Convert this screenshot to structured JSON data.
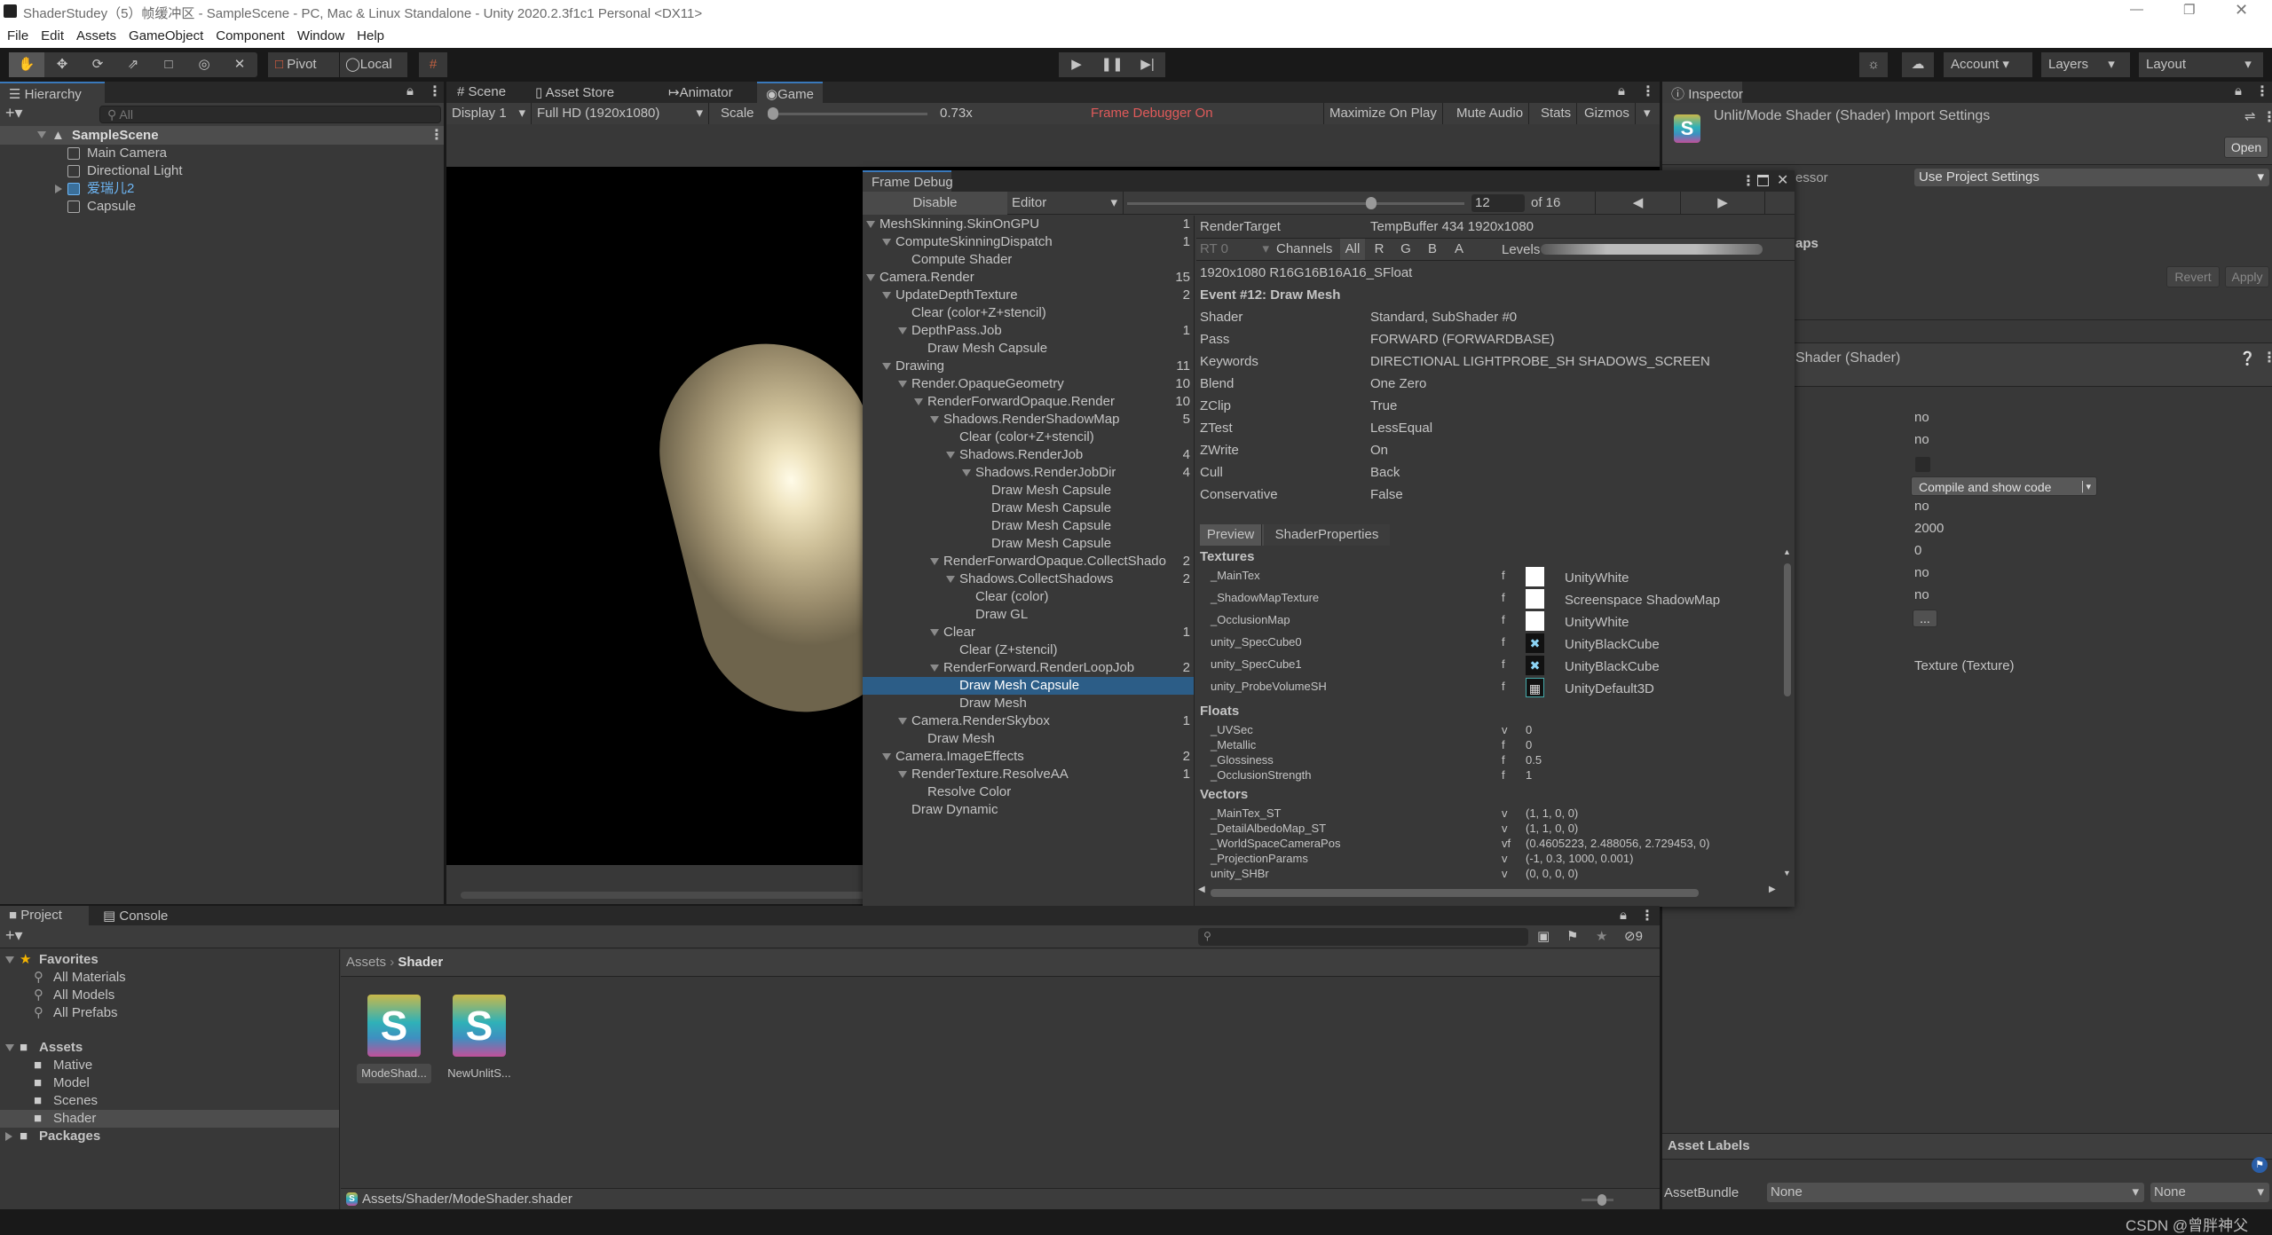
{
  "window": {
    "title": "ShaderStudey（5）帧缓冲区 - SampleScene - PC, Mac & Linux Standalone - Unity 2020.2.3f1c1 Personal <DX11>"
  },
  "menu": [
    "File",
    "Edit",
    "Assets",
    "GameObject",
    "Component",
    "Window",
    "Help"
  ],
  "toolbar": {
    "pivot": "Pivot",
    "local": "Local",
    "account": "Account",
    "layers": "Layers",
    "layout": "Layout"
  },
  "hierarchy": {
    "tab": "Hierarchy",
    "search_placeholder": "All",
    "scene": "SampleScene",
    "items": [
      {
        "label": "Main Camera",
        "prefab": false
      },
      {
        "label": "Directional Light",
        "prefab": false
      },
      {
        "label": "爱瑞儿2",
        "prefab": true
      },
      {
        "label": "Capsule",
        "prefab": false
      }
    ]
  },
  "game": {
    "tabs": [
      "Scene",
      "Asset Store",
      "Animator",
      "Game"
    ],
    "display": "Display 1",
    "resolution": "Full HD (1920x1080)",
    "scale_label": "Scale",
    "scale_value": "0.73x",
    "scale_fraction": 0.0,
    "status": "Frame Debugger On",
    "maximize": "Maximize On Play",
    "mute": "Mute Audio",
    "stats": "Stats",
    "gizmos": "Gizmos",
    "status_color": "#e05a5a"
  },
  "frame_debug": {
    "tab": "Frame Debug",
    "disable": "Disable",
    "target": "Editor",
    "event_index": "12",
    "event_total": "of 16",
    "slider_fraction": 0.73,
    "tree": [
      {
        "label": "MeshSkinning.SkinOnGPU",
        "count": "1",
        "depth": 0,
        "fold": true
      },
      {
        "label": "ComputeSkinningDispatch",
        "count": "1",
        "depth": 1,
        "fold": true
      },
      {
        "label": "Compute Shader",
        "count": "",
        "depth": 2,
        "fold": false
      },
      {
        "label": "Camera.Render",
        "count": "15",
        "depth": 0,
        "fold": true
      },
      {
        "label": "UpdateDepthTexture",
        "count": "2",
        "depth": 1,
        "fold": true
      },
      {
        "label": "Clear (color+Z+stencil)",
        "count": "",
        "depth": 2,
        "fold": false
      },
      {
        "label": "DepthPass.Job",
        "count": "1",
        "depth": 2,
        "fold": true
      },
      {
        "label": "Draw Mesh Capsule",
        "count": "",
        "depth": 3,
        "fold": false
      },
      {
        "label": "Drawing",
        "count": "11",
        "depth": 1,
        "fold": true
      },
      {
        "label": "Render.OpaqueGeometry",
        "count": "10",
        "depth": 2,
        "fold": true
      },
      {
        "label": "RenderForwardOpaque.Render",
        "count": "10",
        "depth": 3,
        "fold": true
      },
      {
        "label": "Shadows.RenderShadowMap",
        "count": "5",
        "depth": 4,
        "fold": true
      },
      {
        "label": "Clear (color+Z+stencil)",
        "count": "",
        "depth": 5,
        "fold": false
      },
      {
        "label": "Shadows.RenderJob",
        "count": "4",
        "depth": 5,
        "fold": true
      },
      {
        "label": "Shadows.RenderJobDir",
        "count": "4",
        "depth": 6,
        "fold": true
      },
      {
        "label": "Draw Mesh Capsule",
        "count": "",
        "depth": 7,
        "fold": false
      },
      {
        "label": "Draw Mesh Capsule",
        "count": "",
        "depth": 7,
        "fold": false
      },
      {
        "label": "Draw Mesh Capsule",
        "count": "",
        "depth": 7,
        "fold": false
      },
      {
        "label": "Draw Mesh Capsule",
        "count": "",
        "depth": 7,
        "fold": false
      },
      {
        "label": "RenderForwardOpaque.CollectShado",
        "count": "2",
        "depth": 4,
        "fold": true
      },
      {
        "label": "Shadows.CollectShadows",
        "count": "2",
        "depth": 5,
        "fold": true
      },
      {
        "label": "Clear (color)",
        "count": "",
        "depth": 6,
        "fold": false
      },
      {
        "label": "Draw GL",
        "count": "",
        "depth": 6,
        "fold": false
      },
      {
        "label": "Clear",
        "count": "1",
        "depth": 4,
        "fold": true
      },
      {
        "label": "Clear (Z+stencil)",
        "count": "",
        "depth": 5,
        "fold": false
      },
      {
        "label": "RenderForward.RenderLoopJob",
        "count": "2",
        "depth": 4,
        "fold": true
      },
      {
        "label": "Draw Mesh Capsule",
        "count": "",
        "depth": 5,
        "fold": false,
        "selected": true
      },
      {
        "label": "Draw Mesh",
        "count": "",
        "depth": 5,
        "fold": false
      },
      {
        "label": "Camera.RenderSkybox",
        "count": "1",
        "depth": 2,
        "fold": true
      },
      {
        "label": "Draw Mesh",
        "count": "",
        "depth": 3,
        "fold": false
      },
      {
        "label": "Camera.ImageEffects",
        "count": "2",
        "depth": 1,
        "fold": true
      },
      {
        "label": "RenderTexture.ResolveAA",
        "count": "1",
        "depth": 2,
        "fold": true
      },
      {
        "label": "Resolve Color",
        "count": "",
        "depth": 3,
        "fold": false
      },
      {
        "label": "Draw Dynamic",
        "count": "",
        "depth": 2,
        "fold": false
      }
    ],
    "render_target_label": "RenderTarget",
    "render_target": "TempBuffer 434 1920x1080",
    "rt": "RT 0",
    "channels": "Channels",
    "channel_buttons": [
      "All",
      "R",
      "G",
      "B",
      "A"
    ],
    "levels": "Levels",
    "format": "1920x1080 R16G16B16A16_SFloat",
    "event": "Event #12: Draw Mesh",
    "props": [
      {
        "k": "Shader",
        "v": "Standard, SubShader #0"
      },
      {
        "k": "Pass",
        "v": "FORWARD (FORWARDBASE)"
      },
      {
        "k": "Keywords",
        "v": "DIRECTIONAL LIGHTPROBE_SH SHADOWS_SCREEN"
      },
      {
        "k": "Blend",
        "v": "One Zero"
      },
      {
        "k": "ZClip",
        "v": "True"
      },
      {
        "k": "ZTest",
        "v": "LessEqual"
      },
      {
        "k": "ZWrite",
        "v": "On"
      },
      {
        "k": "Cull",
        "v": "Back"
      },
      {
        "k": "Conservative",
        "v": "False"
      }
    ],
    "subtabs": [
      "Preview",
      "ShaderProperties"
    ],
    "textures_header": "Textures",
    "textures": [
      {
        "name": "_MainTex",
        "type": "f",
        "value": "UnityWhite",
        "thumb": "white"
      },
      {
        "name": "_ShadowMapTexture",
        "type": "f",
        "value": "Screenspace ShadowMap",
        "thumb": "white"
      },
      {
        "name": "_OcclusionMap",
        "type": "f",
        "value": "UnityWhite",
        "thumb": "white"
      },
      {
        "name": "unity_SpecCube0",
        "type": "f",
        "value": "UnityBlackCube",
        "thumb": "cube"
      },
      {
        "name": "unity_SpecCube1",
        "type": "f",
        "value": "UnityBlackCube",
        "thumb": "cube"
      },
      {
        "name": "unity_ProbeVolumeSH",
        "type": "f",
        "value": "UnityDefault3D",
        "thumb": "3d"
      }
    ],
    "floats_header": "Floats",
    "floats": [
      {
        "name": "_UVSec",
        "type": "v",
        "value": "0"
      },
      {
        "name": "_Metallic",
        "type": "f",
        "value": "0"
      },
      {
        "name": "_Glossiness",
        "type": "f",
        "value": "0.5"
      },
      {
        "name": "_OcclusionStrength",
        "type": "f",
        "value": "1"
      }
    ],
    "vectors_header": "Vectors",
    "vectors": [
      {
        "name": "_MainTex_ST",
        "type": "v",
        "value": "(1, 1, 0, 0)"
      },
      {
        "name": "_DetailAlbedoMap_ST",
        "type": "v",
        "value": "(1, 1, 0, 0)"
      },
      {
        "name": "_WorldSpaceCameraPos",
        "type": "vf",
        "value": "(0.4605223, 2.488056, 2.729453, 0)"
      },
      {
        "name": "_ProjectionParams",
        "type": "v",
        "value": "(-1, 0.3, 1000, 0.001)"
      },
      {
        "name": "unity_SHBr",
        "type": "v",
        "value": "(0, 0, 0, 0)"
      }
    ]
  },
  "inspector": {
    "tab": "Inspector",
    "title": "Unlit/Mode Shader (Shader) Import Settings",
    "open": "Open",
    "preprocessor_label": "essor",
    "preprocessor_value": "Use Project Settings",
    "maps_label": "aps",
    "revert": "Revert",
    "apply": "Apply",
    "shader_header": "Shader (Shader)",
    "values": [
      "no",
      "no",
      "",
      "Compile and show code",
      "no",
      "2000",
      "0",
      "no",
      "no",
      "...",
      "Texture (Texture)"
    ],
    "asset_labels": "Asset Labels",
    "assetbundle_label": "AssetBundle",
    "assetbundle": "None",
    "variant": "None"
  },
  "project": {
    "tabs": [
      "Project",
      "Console"
    ],
    "favorites": "Favorites",
    "favorite_items": [
      "All Materials",
      "All Models",
      "All Prefabs"
    ],
    "assets": "Assets",
    "folders": [
      "Mative",
      "Model",
      "Scenes",
      "Shader"
    ],
    "selected_folder": "Shader",
    "packages": "Packages",
    "breadcrumb": [
      "Assets",
      "Shader"
    ],
    "files": [
      {
        "name": "ModeShad...",
        "selected": true
      },
      {
        "name": "NewUnlitS...",
        "selected": false
      }
    ],
    "hidden_count": "9",
    "status_path": "Assets/Shader/ModeShader.shader"
  },
  "watermark": "CSDN @曾胖神父"
}
